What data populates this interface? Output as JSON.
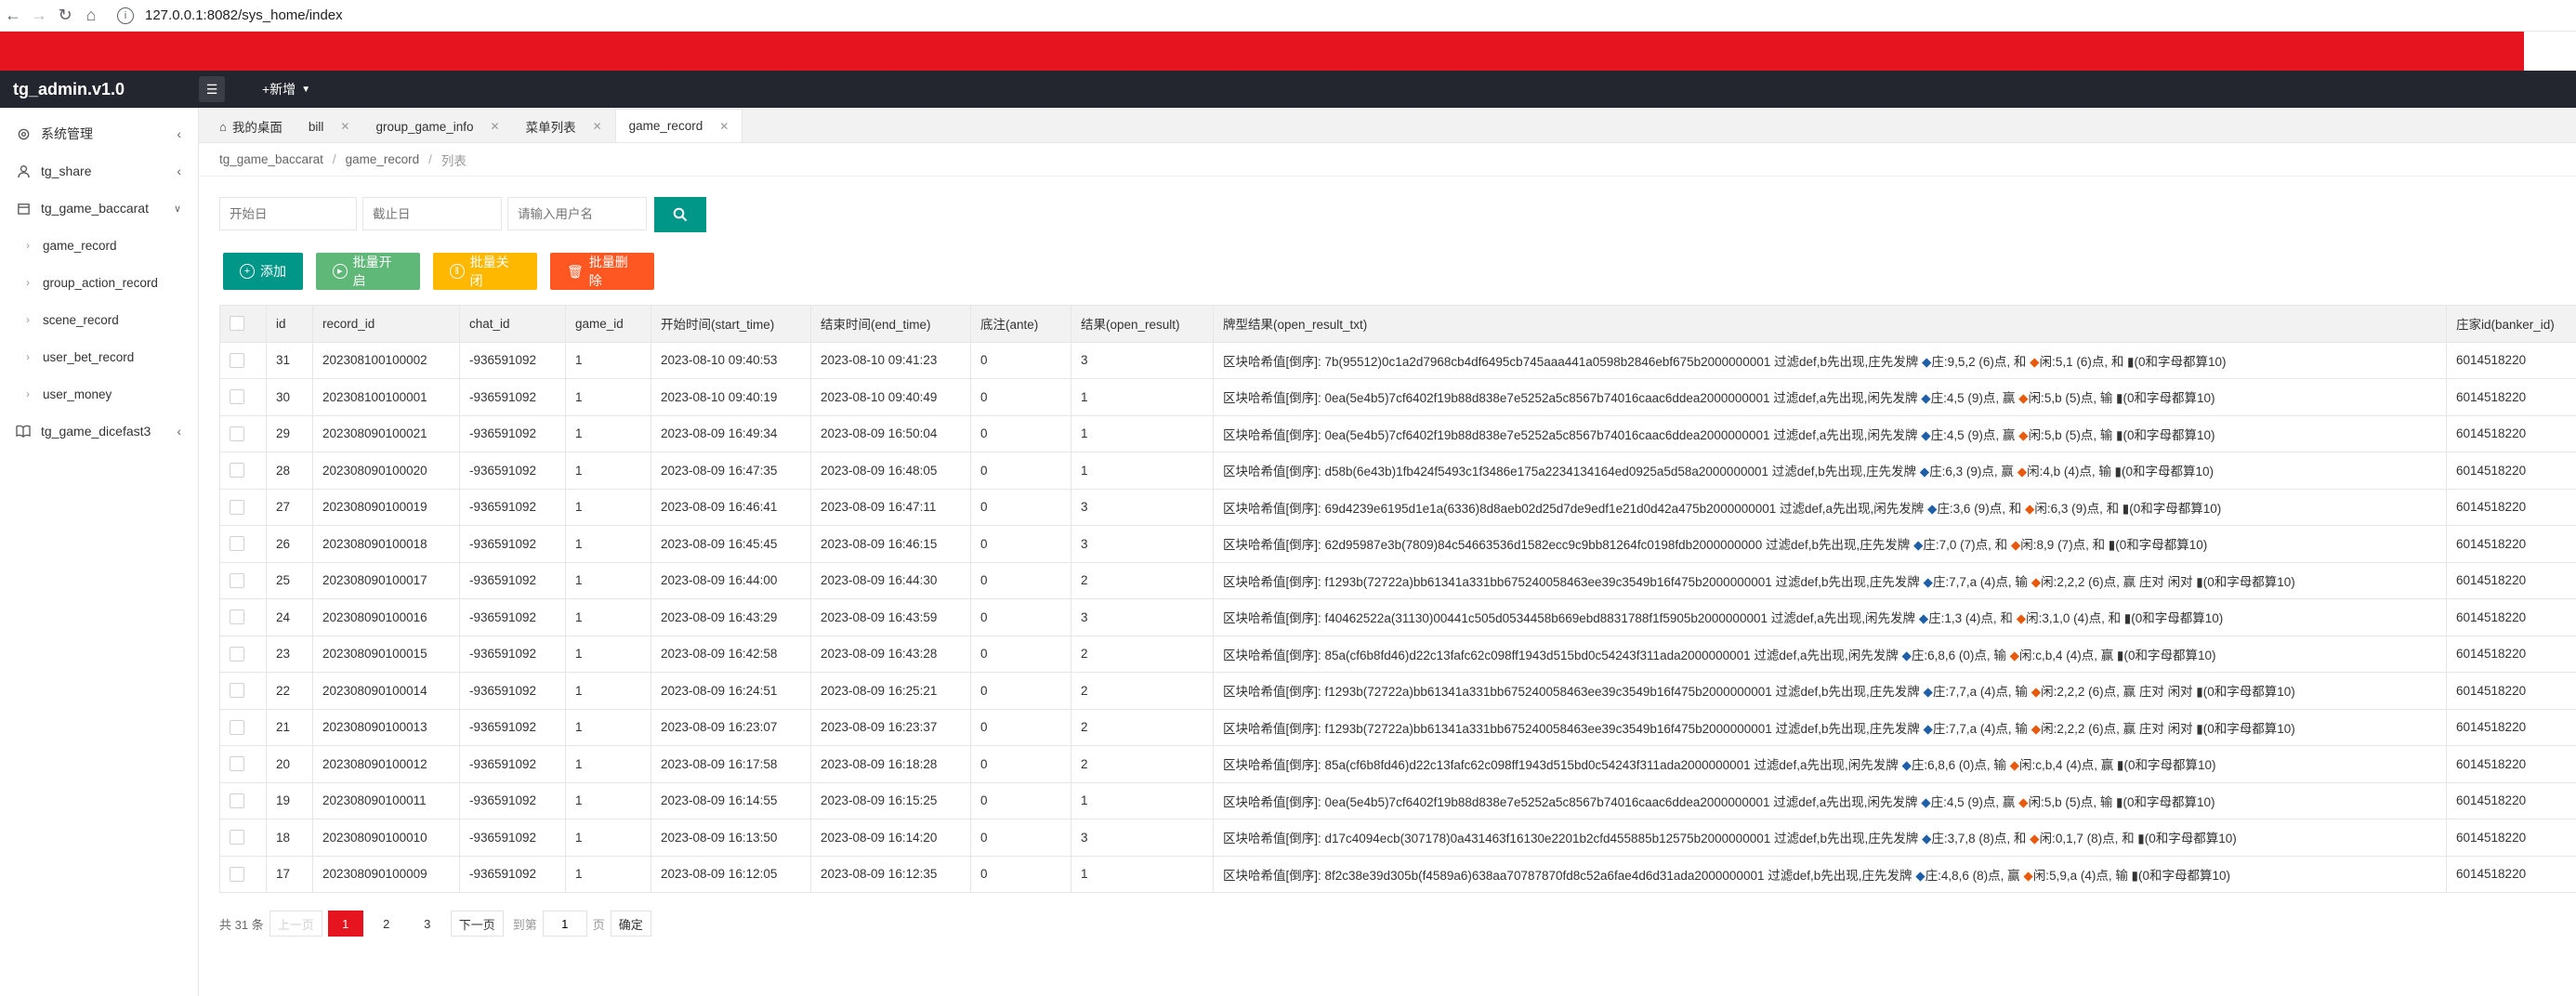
{
  "browser": {
    "url": "127.0.0.1:8082/sys_home/index"
  },
  "app": {
    "brand": "tg_admin.v1.0",
    "add_menu_label": "+新增"
  },
  "sidebar": {
    "items": [
      {
        "label": "系统管理",
        "icon": "gear-icon",
        "arrow": "<"
      },
      {
        "label": "tg_share",
        "icon": "user-icon",
        "arrow": "<"
      },
      {
        "label": "tg_game_baccarat",
        "icon": "calendar-icon",
        "arrow": "v"
      }
    ],
    "subitems": [
      "game_record",
      "group_action_record",
      "scene_record",
      "user_bet_record",
      "user_money"
    ],
    "last_item": {
      "label": "tg_game_dicefast3",
      "icon": "book-icon",
      "arrow": "<"
    }
  },
  "tabs": [
    {
      "label": "我的桌面"
    },
    {
      "label": "bill"
    },
    {
      "label": "group_game_info"
    },
    {
      "label": "菜单列表"
    },
    {
      "label": "game_record"
    }
  ],
  "breadcrumb": [
    "tg_game_baccarat",
    "game_record",
    "列表"
  ],
  "search": {
    "start_placeholder": "开始日",
    "end_placeholder": "截止日",
    "user_placeholder": "请输入用户名"
  },
  "actions": {
    "add": "添加",
    "batch_open": "批量开启",
    "batch_close": "批量关闭",
    "batch_delete": "批量删除"
  },
  "table": {
    "headers": [
      "id",
      "record_id",
      "chat_id",
      "game_id",
      "开始时间(start_time)",
      "结束时间(end_time)",
      "底注(ante)",
      "结果(open_result)",
      "牌型结果(open_result_txt)",
      "庄家id(banker_id)"
    ],
    "rows": [
      {
        "id": "31",
        "record_id": "202308100100002",
        "chat_id": "-936591092",
        "game_id": "1",
        "start": "2023-08-10 09:40:53",
        "end": "2023-08-10 09:41:23",
        "ante": "0",
        "result": "3",
        "txt_a": "区块哈希值[倒序]: 7b(95512)0c1a2d7968cb4df6495cb745aaa441a0598b2846ebf675b2000000001 过滤def,b先出现,庄先发牌 ",
        "txt_b": "庄:9,5,2 (6)点, 和 ",
        "txt_c": "闲:5,1 (6)点, 和 ▮(0和字母都算10)",
        "banker": "6014518220"
      },
      {
        "id": "30",
        "record_id": "202308100100001",
        "chat_id": "-936591092",
        "game_id": "1",
        "start": "2023-08-10 09:40:19",
        "end": "2023-08-10 09:40:49",
        "ante": "0",
        "result": "1",
        "txt_a": "区块哈希值[倒序]: 0ea(5e4b5)7cf6402f19b88d838e7e5252a5c8567b74016caac6ddea2000000001 过滤def,a先出现,闲先发牌 ",
        "txt_b": "庄:4,5 (9)点, 赢 ",
        "txt_c": "闲:5,b (5)点, 输 ▮(0和字母都算10)",
        "banker": "6014518220"
      },
      {
        "id": "29",
        "record_id": "202308090100021",
        "chat_id": "-936591092",
        "game_id": "1",
        "start": "2023-08-09 16:49:34",
        "end": "2023-08-09 16:50:04",
        "ante": "0",
        "result": "1",
        "txt_a": "区块哈希值[倒序]: 0ea(5e4b5)7cf6402f19b88d838e7e5252a5c8567b74016caac6ddea2000000001 过滤def,a先出现,闲先发牌 ",
        "txt_b": "庄:4,5 (9)点, 赢 ",
        "txt_c": "闲:5,b (5)点, 输 ▮(0和字母都算10)",
        "banker": "6014518220"
      },
      {
        "id": "28",
        "record_id": "202308090100020",
        "chat_id": "-936591092",
        "game_id": "1",
        "start": "2023-08-09 16:47:35",
        "end": "2023-08-09 16:48:05",
        "ante": "0",
        "result": "1",
        "txt_a": "区块哈希值[倒序]: d58b(6e43b)1fb424f5493c1f3486e175a2234134164ed0925a5d58a2000000001 过滤def,b先出现,庄先发牌 ",
        "txt_b": "庄:6,3 (9)点, 赢 ",
        "txt_c": "闲:4,b (4)点, 输 ▮(0和字母都算10)",
        "banker": "6014518220"
      },
      {
        "id": "27",
        "record_id": "202308090100019",
        "chat_id": "-936591092",
        "game_id": "1",
        "start": "2023-08-09 16:46:41",
        "end": "2023-08-09 16:47:11",
        "ante": "0",
        "result": "3",
        "txt_a": "区块哈希值[倒序]: 69d4239e6195d1e1a(6336)8d8aeb02d25d7de9edf1e21d0d42a475b2000000001 过滤def,a先出现,闲先发牌 ",
        "txt_b": "庄:3,6 (9)点, 和 ",
        "txt_c": "闲:6,3 (9)点, 和 ▮(0和字母都算10)",
        "banker": "6014518220"
      },
      {
        "id": "26",
        "record_id": "202308090100018",
        "chat_id": "-936591092",
        "game_id": "1",
        "start": "2023-08-09 16:45:45",
        "end": "2023-08-09 16:46:15",
        "ante": "0",
        "result": "3",
        "txt_a": "区块哈希值[倒序]: 62d95987e3b(7809)84c54663536d1582ecc9c9bb81264fc0198fdb2000000000 过滤def,b先出现,庄先发牌 ",
        "txt_b": "庄:7,0 (7)点, 和 ",
        "txt_c": "闲:8,9 (7)点, 和 ▮(0和字母都算10)",
        "banker": "6014518220"
      },
      {
        "id": "25",
        "record_id": "202308090100017",
        "chat_id": "-936591092",
        "game_id": "1",
        "start": "2023-08-09 16:44:00",
        "end": "2023-08-09 16:44:30",
        "ante": "0",
        "result": "2",
        "txt_a": "区块哈希值[倒序]: f1293b(72722a)bb61341a331bb675240058463ee39c3549b16f475b2000000001 过滤def,b先出现,庄先发牌 ",
        "txt_b": "庄:7,7,a (4)点, 输 ",
        "txt_c": "闲:2,2,2 (6)点, 赢 庄对 闲对 ▮(0和字母都算10)",
        "banker": "6014518220"
      },
      {
        "id": "24",
        "record_id": "202308090100016",
        "chat_id": "-936591092",
        "game_id": "1",
        "start": "2023-08-09 16:43:29",
        "end": "2023-08-09 16:43:59",
        "ante": "0",
        "result": "3",
        "txt_a": "区块哈希值[倒序]: f40462522a(31130)00441c505d0534458b669ebd8831788f1f5905b2000000001 过滤def,a先出现,闲先发牌 ",
        "txt_b": "庄:1,3 (4)点, 和 ",
        "txt_c": "闲:3,1,0 (4)点, 和 ▮(0和字母都算10)",
        "banker": "6014518220"
      },
      {
        "id": "23",
        "record_id": "202308090100015",
        "chat_id": "-936591092",
        "game_id": "1",
        "start": "2023-08-09 16:42:58",
        "end": "2023-08-09 16:43:28",
        "ante": "0",
        "result": "2",
        "txt_a": "区块哈希值[倒序]: 85a(cf6b8fd46)d22c13fafc62c098ff1943d515bd0c54243f311ada2000000001 过滤def,a先出现,闲先发牌 ",
        "txt_b": "庄:6,8,6 (0)点, 输 ",
        "txt_c": "闲:c,b,4 (4)点, 赢 ▮(0和字母都算10)",
        "banker": "6014518220"
      },
      {
        "id": "22",
        "record_id": "202308090100014",
        "chat_id": "-936591092",
        "game_id": "1",
        "start": "2023-08-09 16:24:51",
        "end": "2023-08-09 16:25:21",
        "ante": "0",
        "result": "2",
        "txt_a": "区块哈希值[倒序]: f1293b(72722a)bb61341a331bb675240058463ee39c3549b16f475b2000000001 过滤def,b先出现,庄先发牌 ",
        "txt_b": "庄:7,7,a (4)点, 输 ",
        "txt_c": "闲:2,2,2 (6)点, 赢 庄对 闲对 ▮(0和字母都算10)",
        "banker": "6014518220"
      },
      {
        "id": "21",
        "record_id": "202308090100013",
        "chat_id": "-936591092",
        "game_id": "1",
        "start": "2023-08-09 16:23:07",
        "end": "2023-08-09 16:23:37",
        "ante": "0",
        "result": "2",
        "txt_a": "区块哈希值[倒序]: f1293b(72722a)bb61341a331bb675240058463ee39c3549b16f475b2000000001 过滤def,b先出现,庄先发牌 ",
        "txt_b": "庄:7,7,a (4)点, 输 ",
        "txt_c": "闲:2,2,2 (6)点, 赢 庄对 闲对 ▮(0和字母都算10)",
        "banker": "6014518220"
      },
      {
        "id": "20",
        "record_id": "202308090100012",
        "chat_id": "-936591092",
        "game_id": "1",
        "start": "2023-08-09 16:17:58",
        "end": "2023-08-09 16:18:28",
        "ante": "0",
        "result": "2",
        "txt_a": "区块哈希值[倒序]: 85a(cf6b8fd46)d22c13fafc62c098ff1943d515bd0c54243f311ada2000000001 过滤def,a先出现,闲先发牌 ",
        "txt_b": "庄:6,8,6 (0)点, 输 ",
        "txt_c": "闲:c,b,4 (4)点, 赢 ▮(0和字母都算10)",
        "banker": "6014518220"
      },
      {
        "id": "19",
        "record_id": "202308090100011",
        "chat_id": "-936591092",
        "game_id": "1",
        "start": "2023-08-09 16:14:55",
        "end": "2023-08-09 16:15:25",
        "ante": "0",
        "result": "1",
        "txt_a": "区块哈希值[倒序]: 0ea(5e4b5)7cf6402f19b88d838e7e5252a5c8567b74016caac6ddea2000000001 过滤def,a先出现,闲先发牌 ",
        "txt_b": "庄:4,5 (9)点, 赢 ",
        "txt_c": "闲:5,b (5)点, 输 ▮(0和字母都算10)",
        "banker": "6014518220"
      },
      {
        "id": "18",
        "record_id": "202308090100010",
        "chat_id": "-936591092",
        "game_id": "1",
        "start": "2023-08-09 16:13:50",
        "end": "2023-08-09 16:14:20",
        "ante": "0",
        "result": "3",
        "txt_a": "区块哈希值[倒序]: d17c4094ecb(307178)0a431463f16130e2201b2cfd455885b12575b2000000001 过滤def,b先出现,庄先发牌 ",
        "txt_b": "庄:3,7,8 (8)点, 和 ",
        "txt_c": "闲:0,1,7 (8)点, 和 ▮(0和字母都算10)",
        "banker": "6014518220"
      },
      {
        "id": "17",
        "record_id": "202308090100009",
        "chat_id": "-936591092",
        "game_id": "1",
        "start": "2023-08-09 16:12:05",
        "end": "2023-08-09 16:12:35",
        "ante": "0",
        "result": "1",
        "txt_a": "区块哈希值[倒序]: 8f2c38e39d305b(f4589a6)638aa70787870fd8c52a6fae4d6d31ada2000000001 过滤def,b先出现,庄先发牌 ",
        "txt_b": "庄:4,8,6 (8)点, 赢 ",
        "txt_c": "闲:5,9,a (4)点, 输 ▮(0和字母都算10)",
        "banker": "6014518220"
      }
    ]
  },
  "pager": {
    "total": "共 31 条",
    "prev": "上一页",
    "pages": [
      "1",
      "2",
      "3"
    ],
    "current": "1",
    "next": "下一页",
    "goto_label": "到第",
    "goto_value": "1",
    "page_unit": "页",
    "confirm": "确定"
  },
  "colors": {
    "banner": "#e5141f",
    "topbar": "#23262e",
    "primary": "#009688",
    "green": "#5fb878",
    "yellow": "#ffb800",
    "orange": "#ff5722",
    "banker_diamond": "#1e5fa8",
    "player_diamond": "#e8590c"
  }
}
